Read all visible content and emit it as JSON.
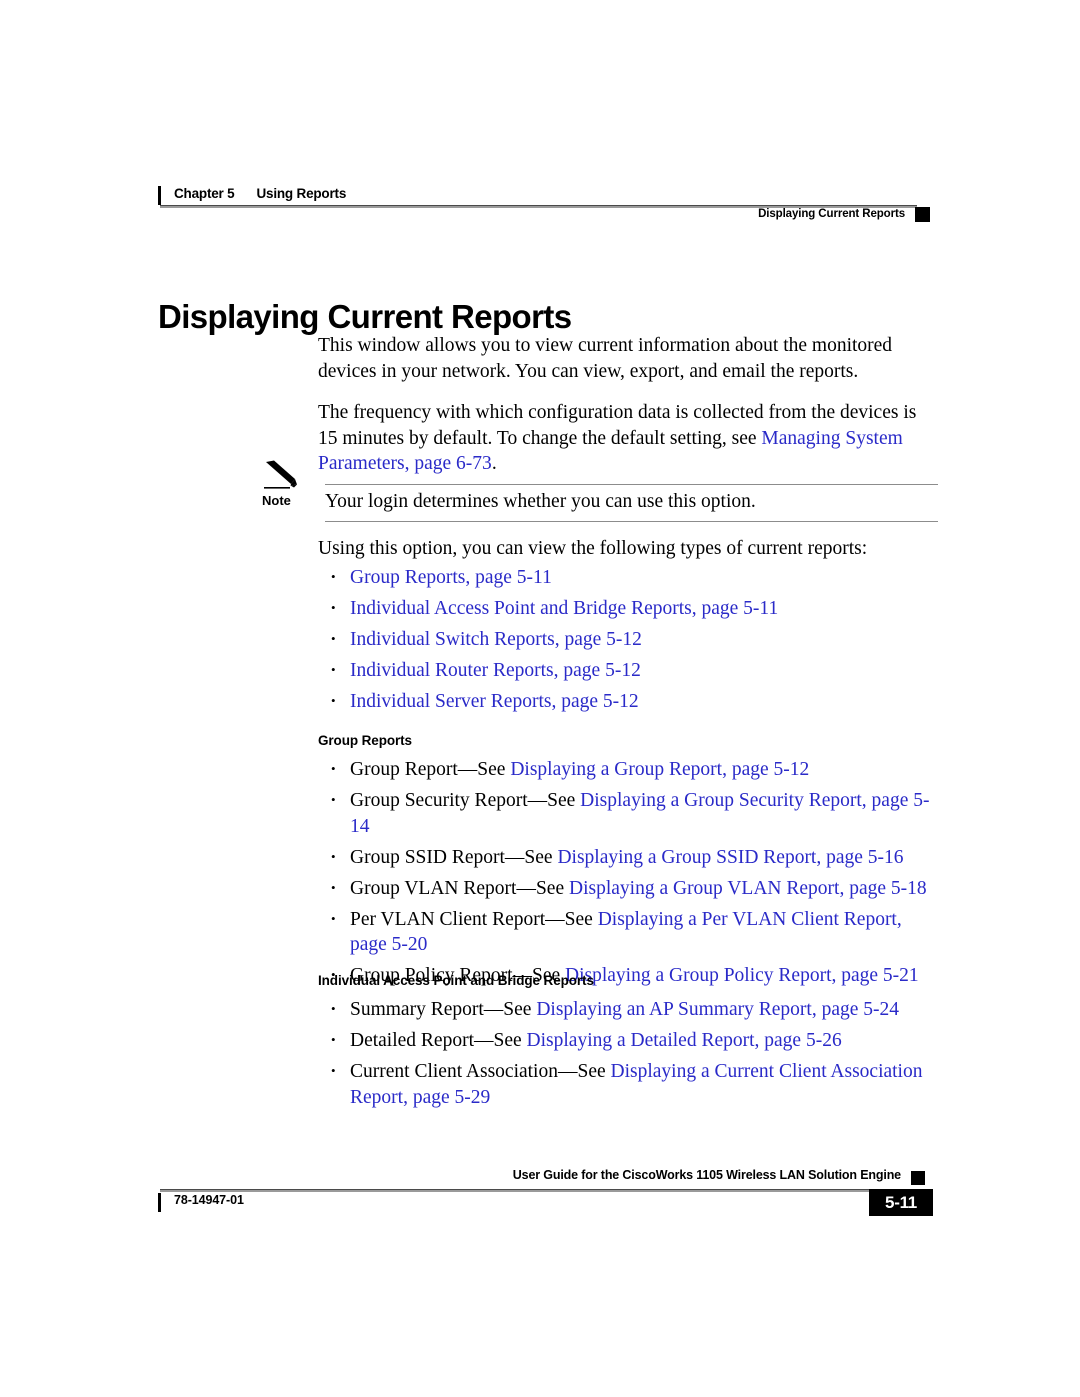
{
  "header": {
    "chapter": "Chapter 5",
    "chapter_title": "Using Reports",
    "section": "Displaying Current Reports"
  },
  "title": "Displaying Current Reports",
  "paragraphs": {
    "p1": "This window allows you to view current information about the monitored devices in your network. You can view, export, and email the reports.",
    "p2_before": "The frequency with which configuration data is collected from the devices is 15 minutes by default. To change the default setting, see ",
    "p2_link": "Managing System Parameters, page 6-73",
    "p2_after": "."
  },
  "note": {
    "icon": "pencil-icon",
    "label": "Note",
    "text": "Your login determines whether you can use this option."
  },
  "intro_line": "Using this option, you can view the following types of current reports:",
  "link_list": [
    {
      "text": "Group Reports, page 5-11"
    },
    {
      "text": "Individual Access Point and Bridge Reports, page 5-11"
    },
    {
      "text": "Individual Switch Reports, page 5-12"
    },
    {
      "text": "Individual Router Reports, page 5-12"
    },
    {
      "text": "Individual Server Reports, page 5-12"
    }
  ],
  "sections": [
    {
      "heading": "Group Reports",
      "items": [
        {
          "prefix": "Group Report—See ",
          "link": "Displaying a Group Report, page 5-12"
        },
        {
          "prefix": "Group Security Report—See ",
          "link": "Displaying a Group Security Report, page 5-14"
        },
        {
          "prefix": "Group SSID Report—See ",
          "link": "Displaying a Group SSID Report, page 5-16"
        },
        {
          "prefix": "Group VLAN Report—See ",
          "link": "Displaying a Group VLAN Report, page 5-18"
        },
        {
          "prefix": "Per VLAN Client Report—See ",
          "link": "Displaying a Per VLAN Client Report, page 5-20"
        },
        {
          "prefix": "Group Policy Report—See ",
          "link": "Displaying a Group Policy Report, page 5-21"
        }
      ]
    },
    {
      "heading": "Individual Access Point and Bridge Reports",
      "items": [
        {
          "prefix": "Summary Report—See ",
          "link": "Displaying an AP Summary Report, page 5-24"
        },
        {
          "prefix": "Detailed Report—See ",
          "link": "Displaying a Detailed Report, page 5-26"
        },
        {
          "prefix": "Current Client Association—See ",
          "link": "Displaying a Current Client Association Report, page 5-29"
        }
      ]
    }
  ],
  "footer": {
    "guide_title": "User Guide for the CiscoWorks 1105 Wireless LAN Solution Engine",
    "doc_number": "78-14947-01",
    "page_number": "5-11"
  },
  "colors": {
    "link": "#2a2ac8",
    "text": "#000000",
    "rule": "#9a9a9a"
  }
}
